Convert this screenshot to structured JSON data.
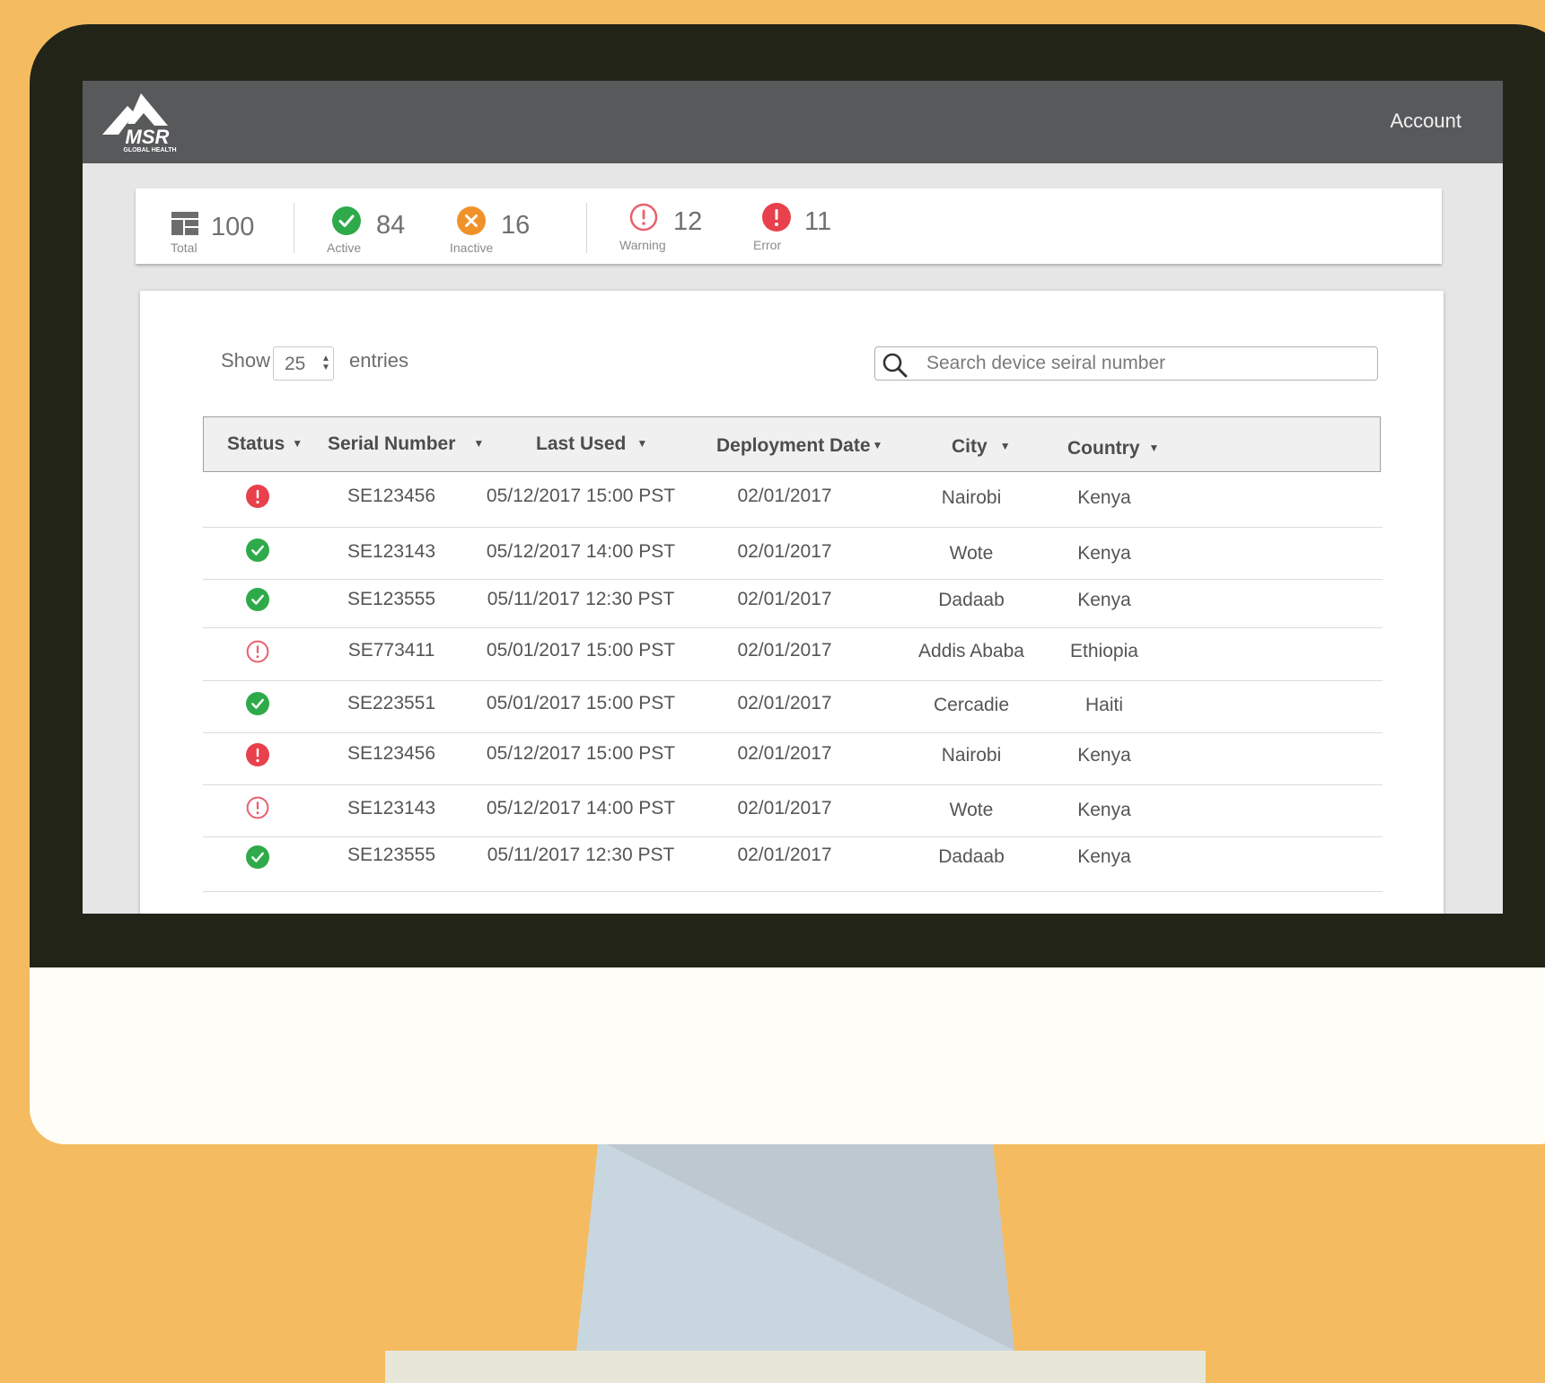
{
  "header": {
    "logo_text": "MSR",
    "logo_sub": "GLOBAL HEALTH",
    "account_label": "Account"
  },
  "stats": [
    {
      "name": "total",
      "icon": "table-icon",
      "value": "100",
      "label": "Total"
    },
    {
      "name": "active",
      "icon": "check-circle-icon",
      "value": "84",
      "label": "Active",
      "color": "#2eaa4a"
    },
    {
      "name": "inactive",
      "icon": "x-circle-icon",
      "value": "16",
      "label": "Inactive",
      "color": "#f0922a"
    },
    {
      "name": "warning",
      "icon": "alert-outline-icon",
      "value": "12",
      "label": "Warning",
      "color": "#e8616e"
    },
    {
      "name": "error",
      "icon": "alert-filled-icon",
      "value": "11",
      "label": "Error",
      "color": "#e8404c"
    }
  ],
  "controls": {
    "show_label": "Show",
    "entries_value": "25",
    "entries_label": "entries",
    "search_placeholder": "Search device seiral number"
  },
  "table": {
    "columns": [
      "Status",
      "Serial Number",
      "Last Used",
      "Deployment Date",
      "City",
      "Country"
    ],
    "rows": [
      {
        "status": "error",
        "serial": "SE123456",
        "last_used": "05/12/2017 15:00 PST",
        "deployment": "02/01/2017",
        "city": "Nairobi",
        "country": "Kenya"
      },
      {
        "status": "active",
        "serial": "SE123143",
        "last_used": "05/12/2017 14:00 PST",
        "deployment": "02/01/2017",
        "city": "Wote",
        "country": "Kenya"
      },
      {
        "status": "active",
        "serial": "SE123555",
        "last_used": "05/11/2017 12:30 PST",
        "deployment": "02/01/2017",
        "city": "Dadaab",
        "country": "Kenya"
      },
      {
        "status": "warning",
        "serial": "SE773411",
        "last_used": "05/01/2017 15:00 PST",
        "deployment": "02/01/2017",
        "city": "Addis Ababa",
        "country": "Ethiopia"
      },
      {
        "status": "active",
        "serial": "SE223551",
        "last_used": "05/01/2017 15:00 PST",
        "deployment": "02/01/2017",
        "city": "Cercadie",
        "country": "Haiti"
      },
      {
        "status": "error",
        "serial": "SE123456",
        "last_used": "05/12/2017 15:00 PST",
        "deployment": "02/01/2017",
        "city": "Nairobi",
        "country": "Kenya"
      },
      {
        "status": "warning",
        "serial": "SE123143",
        "last_used": "05/12/2017 14:00 PST",
        "deployment": "02/01/2017",
        "city": "Wote",
        "country": "Kenya"
      },
      {
        "status": "active",
        "serial": "SE123555",
        "last_used": "05/11/2017 12:30 PST",
        "deployment": "02/01/2017",
        "city": "Dadaab",
        "country": "Kenya"
      }
    ]
  },
  "colors": {
    "background": "#f5bb60",
    "topbar": "#58595b",
    "active": "#2eaa4a",
    "inactive": "#f0922a",
    "warning": "#e8616e",
    "error": "#e8404c"
  }
}
